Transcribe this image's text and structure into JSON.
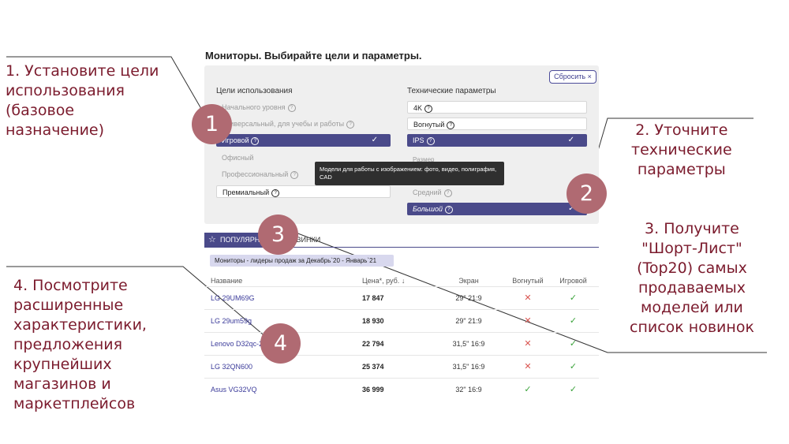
{
  "callouts": {
    "c1": "1. Установите цели\nиспользования\n(базовое\nназначение)",
    "c2": "2. Уточните\nтехнические\nпараметры",
    "c3": "3. Получите\n\"Шорт-Лист\"\n(Top20) самых\nпродаваемых\nмоделей или\nсписок новинок",
    "c4": "4. Посмотрите\nрасширенные\nхарактеристики,\nпредложения\nкрупнейших\nмагазинов и\nмаркетплейсов"
  },
  "badges": [
    "1",
    "2",
    "3",
    "4"
  ],
  "page_title": "Мониторы. Выбирайте цели и параметры.",
  "reset_label": "Сбросить ×",
  "goals": {
    "header": "Цели использования",
    "items": [
      {
        "label": "Начального уровня",
        "state": "dim"
      },
      {
        "label": "Универсальный, для учебы и работы",
        "state": "dim"
      },
      {
        "label": "Игровой",
        "state": "selected"
      },
      {
        "label": "Офисный",
        "state": "dim"
      },
      {
        "label": "Профессиональный",
        "state": "dim"
      },
      {
        "label": "Премиальный",
        "state": "boxed"
      }
    ]
  },
  "tech": {
    "header": "Технические параметры",
    "items": [
      {
        "label": "4K",
        "state": "boxed"
      },
      {
        "label": "Вогнутый",
        "state": "boxed"
      },
      {
        "label": "IPS",
        "state": "selected"
      },
      {
        "label": "Размер",
        "state": "dim"
      },
      {
        "label": "Средний",
        "state": "dim"
      },
      {
        "label": "Большой",
        "state": "selected"
      }
    ]
  },
  "tooltip": "Модели для работы с изображением: фото, видео, полиграфия, CAD",
  "tabs": {
    "popular": "ПОПУЛЯРНЫЕ",
    "new": "НОВИНКИ"
  },
  "chip": "Мониторы - лидеры продаж за Декабрь`20 - Январь`21",
  "table": {
    "headers": {
      "name": "Название",
      "price": "Цена*, руб.",
      "screen": "Экран",
      "curved": "Вогнутый",
      "gaming": "Игровой"
    },
    "rows": [
      {
        "name": "LG 29UM69G",
        "price": "17 847",
        "screen": "29\" 21:9",
        "curved": "✕",
        "gaming": "✓"
      },
      {
        "name": "LG 29um59g",
        "price": "18 930",
        "screen": "29\" 21:9",
        "curved": "✕",
        "gaming": "✓"
      },
      {
        "name": "Lenovo D32qc-20",
        "price": "22 794",
        "screen": "31,5\" 16:9",
        "curved": "✕",
        "gaming": "✓"
      },
      {
        "name": "LG 32QN600",
        "price": "25 374",
        "screen": "31,5\" 16:9",
        "curved": "✕",
        "gaming": "✓"
      },
      {
        "name": "Asus VG32VQ",
        "price": "36 999",
        "screen": "32\" 16:9",
        "curved": "✓",
        "gaming": "✓"
      }
    ]
  },
  "colors": {
    "accent": "#4a4a8a",
    "callout": "#7b1b2d",
    "badge": "#b06a72",
    "ok": "#3aa33a",
    "no": "#d9534f"
  }
}
